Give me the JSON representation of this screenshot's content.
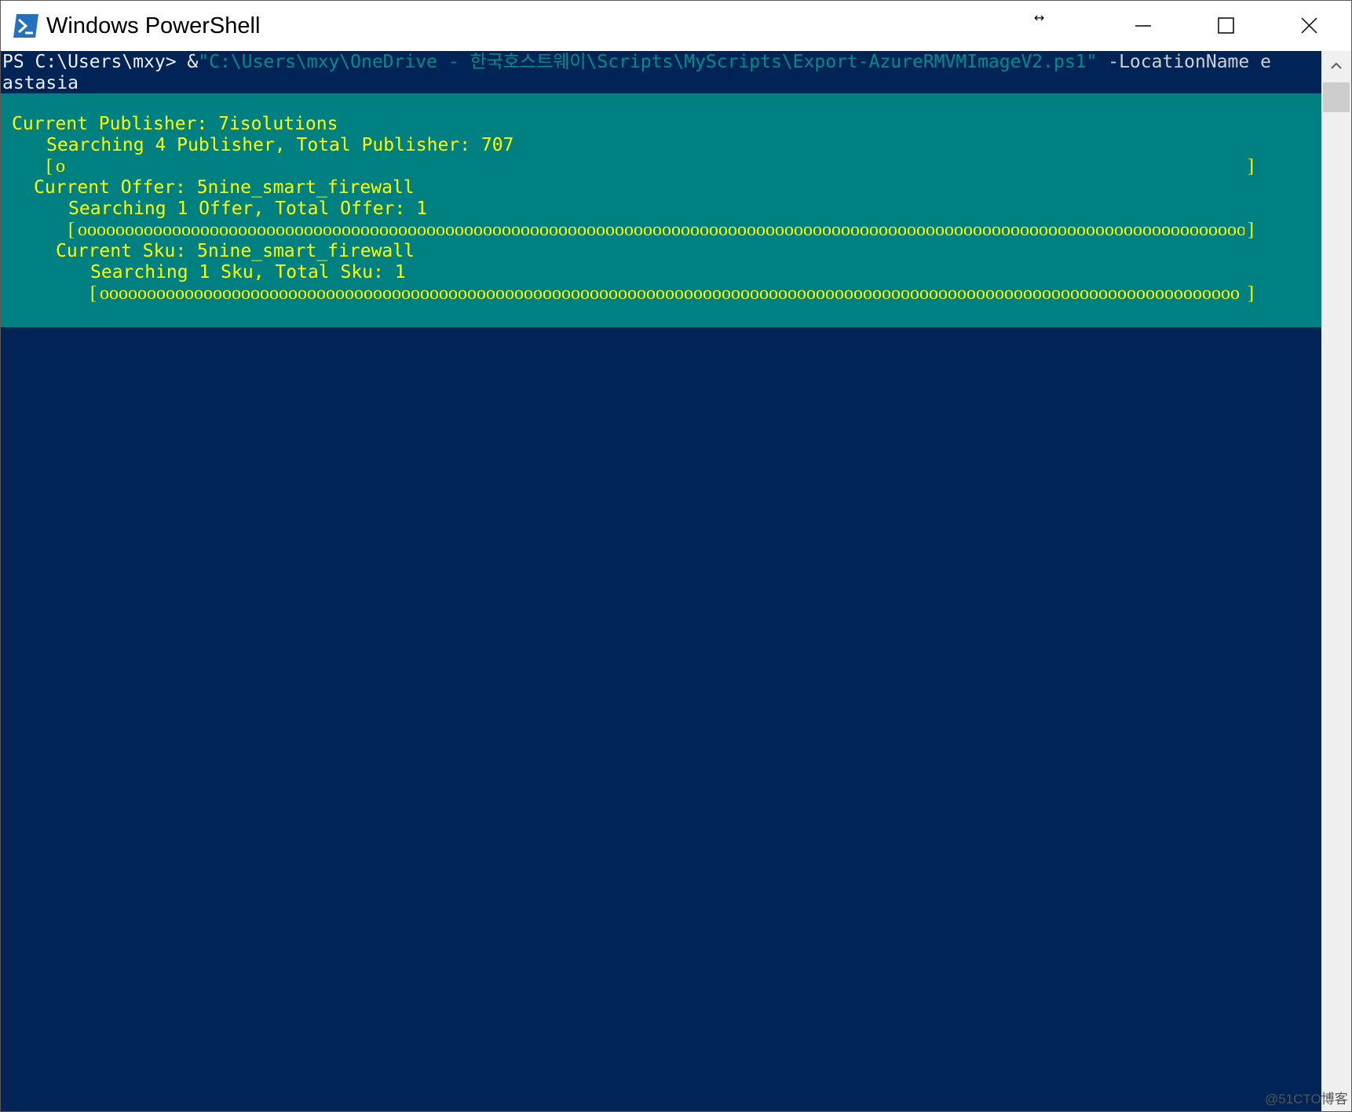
{
  "window": {
    "title": "Windows PowerShell",
    "resize_glyph": "↔",
    "icon": "powershell-icon"
  },
  "console": {
    "prompt": "PS C:\\Users\\mxy> ",
    "operator": "&",
    "script_path": "\"C:\\Users\\mxy\\OneDrive - 한국호스트웨이\\Scripts\\MyScripts\\Export-AzureRMVMImageV2.ps1\"",
    "param_name": " -LocationName e",
    "param_value_wrap": "astasia"
  },
  "progress": {
    "publisher": {
      "activity": "Current Publisher: 7isolutions",
      "status": "Searching 4 Publisher, Total Publisher: 707",
      "fraction": 0.0057
    },
    "offer": {
      "activity": "Current Offer: 5nine_smart_firewall",
      "status": "Searching 1 Offer, Total Offer: 1",
      "fraction": 1.0
    },
    "sku": {
      "activity": "Current Sku: 5nine_smart_firewall",
      "status": "Searching 1 Sku, Total Sku: 1",
      "fraction": 1.0
    },
    "bar_open": "[",
    "bar_close": "]"
  },
  "watermark": "@51CTO博客",
  "colors": {
    "console_bg": "#012456",
    "progress_bg": "#008080",
    "progress_text": "#ffff00",
    "path_string": "#008b8b"
  }
}
